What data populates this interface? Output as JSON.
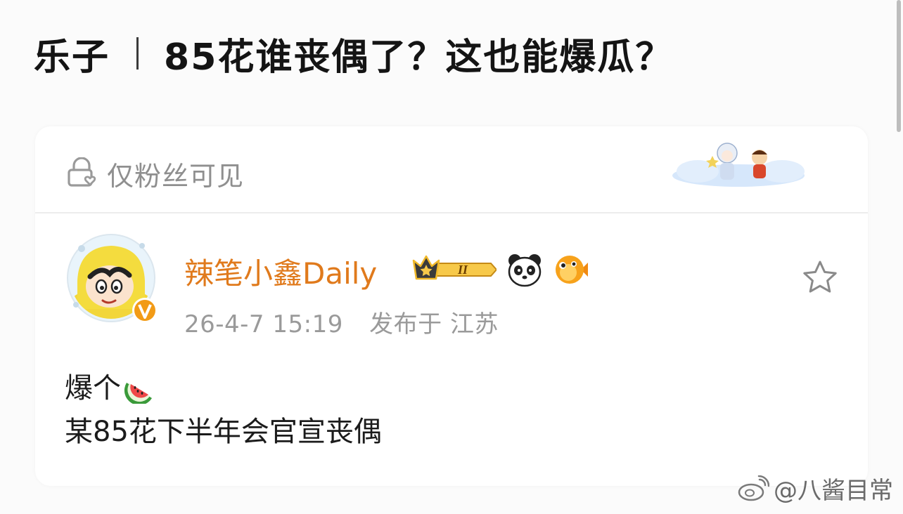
{
  "headline": {
    "category": "乐子",
    "title": "85花谁丧偶了？这也能爆瓜？"
  },
  "post": {
    "visibility_icon": "lock-heart-icon",
    "visibility_label": "仅粉丝可见",
    "author": {
      "name": "辣笔小鑫Daily",
      "level_badge": "II",
      "verified_badge": "V"
    },
    "timestamp": "26-4-7 15:19",
    "location": "发布于 江苏",
    "body": {
      "line1": "爆个",
      "line1_emoji": "watermelon-icon",
      "line2": "某85花下半年会官宣丧偶"
    }
  },
  "watermark": {
    "text": "@八酱目常",
    "icon": "weibo-icon"
  },
  "colors": {
    "author_name": "#e07a1c",
    "meta": "#9a9a9a",
    "visibility": "#8f8f8f"
  }
}
